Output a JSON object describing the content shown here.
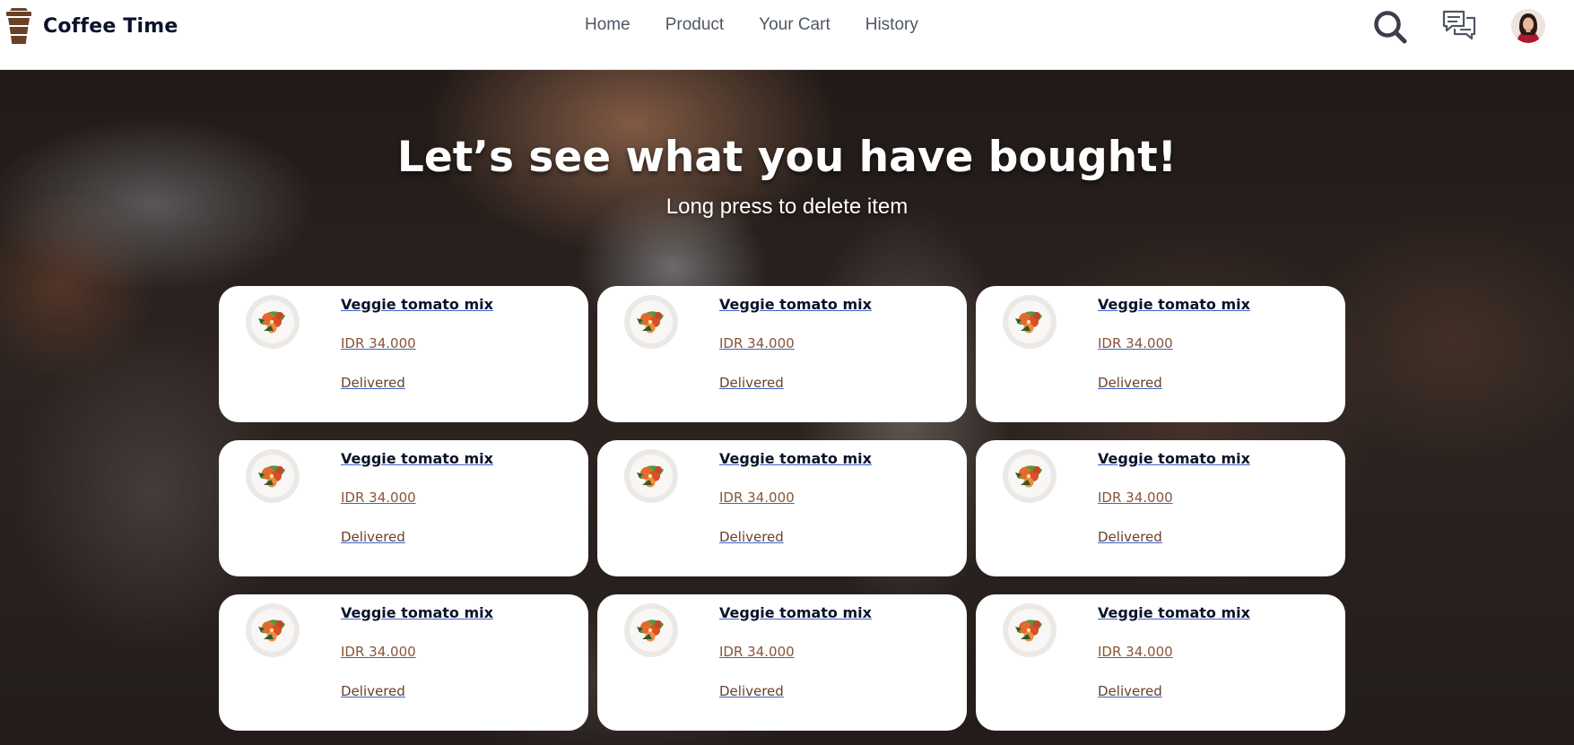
{
  "brand": {
    "name": "Coffee Time",
    "logo_icon": "coffee-cup-icon"
  },
  "nav": {
    "links": [
      {
        "label": "Home"
      },
      {
        "label": "Product"
      },
      {
        "label": "Your Cart"
      },
      {
        "label": "History"
      }
    ],
    "icons": [
      "search-icon",
      "chat-icon",
      "avatar"
    ]
  },
  "hero": {
    "title": "Let’s see what you have bought!",
    "subtitle": "Long press to delete item"
  },
  "history": {
    "items": [
      {
        "name": "Veggie tomato mix",
        "price": "IDR 34.000",
        "status": "Delivered",
        "image_icon": "veggie-tomato-mix-image"
      },
      {
        "name": "Veggie tomato mix",
        "price": "IDR 34.000",
        "status": "Delivered",
        "image_icon": "veggie-tomato-mix-image"
      },
      {
        "name": "Veggie tomato mix",
        "price": "IDR 34.000",
        "status": "Delivered",
        "image_icon": "veggie-tomato-mix-image"
      },
      {
        "name": "Veggie tomato mix",
        "price": "IDR 34.000",
        "status": "Delivered",
        "image_icon": "veggie-tomato-mix-image"
      },
      {
        "name": "Veggie tomato mix",
        "price": "IDR 34.000",
        "status": "Delivered",
        "image_icon": "veggie-tomato-mix-image"
      },
      {
        "name": "Veggie tomato mix",
        "price": "IDR 34.000",
        "status": "Delivered",
        "image_icon": "veggie-tomato-mix-image"
      },
      {
        "name": "Veggie tomato mix",
        "price": "IDR 34.000",
        "status": "Delivered",
        "image_icon": "veggie-tomato-mix-image"
      },
      {
        "name": "Veggie tomato mix",
        "price": "IDR 34.000",
        "status": "Delivered",
        "image_icon": "veggie-tomato-mix-image"
      },
      {
        "name": "Veggie tomato mix",
        "price": "IDR 34.000",
        "status": "Delivered",
        "image_icon": "veggie-tomato-mix-image"
      }
    ]
  },
  "colors": {
    "brand_dark": "#0b132a",
    "nav_text": "#4f5665",
    "coffee_brown": "#6a4029",
    "price_brown": "#895537",
    "link_underline": "#3c63c9"
  }
}
